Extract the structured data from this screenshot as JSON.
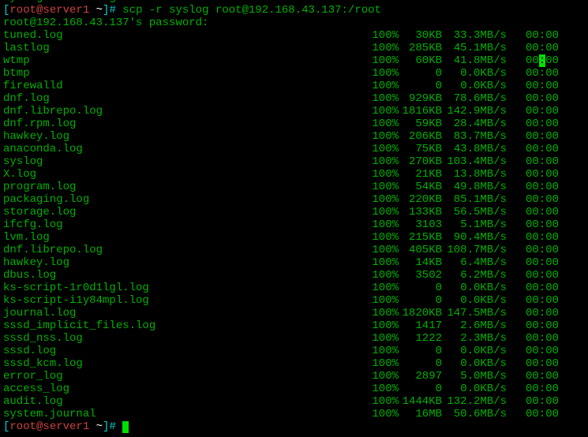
{
  "top_fragment": "syslog: not a regular file",
  "prompt1": {
    "open": "[",
    "userhost": "root@server1",
    "tilde": " ~",
    "close": "]# ",
    "command": "scp -r syslog root@192.168.43.137:/root"
  },
  "password_line": "root@192.168.43.137's password:",
  "files": [
    {
      "name": "tuned.log",
      "pct": "100%",
      "size": "30KB",
      "rate": "33.3MB/s",
      "time": "00:00"
    },
    {
      "name": "lastlog",
      "pct": "100%",
      "size": "285KB",
      "rate": "45.1MB/s",
      "time": "00:00"
    },
    {
      "name": "wtmp",
      "pct": "100%",
      "size": "60KB",
      "rate": "41.8MB/s",
      "time": "00:00",
      "time_hl": true,
      "time_pre": "00",
      "time_hl_ch": ":",
      "time_post": "00"
    },
    {
      "name": "btmp",
      "pct": "100%",
      "size": "0",
      "rate": "0.0KB/s",
      "time": "00:00"
    },
    {
      "name": "firewalld",
      "pct": "100%",
      "size": "0",
      "rate": "0.0KB/s",
      "time": "00:00"
    },
    {
      "name": "dnf.log",
      "pct": "100%",
      "size": "929KB",
      "rate": "78.6MB/s",
      "time": "00:00"
    },
    {
      "name": "dnf.librepo.log",
      "pct": "100%",
      "size": "1816KB",
      "rate": "142.9MB/s",
      "time": "00:00"
    },
    {
      "name": "dnf.rpm.log",
      "pct": "100%",
      "size": "59KB",
      "rate": "28.4MB/s",
      "time": "00:00"
    },
    {
      "name": "hawkey.log",
      "pct": "100%",
      "size": "206KB",
      "rate": "83.7MB/s",
      "time": "00:00"
    },
    {
      "name": "anaconda.log",
      "pct": "100%",
      "size": "75KB",
      "rate": "43.8MB/s",
      "time": "00:00"
    },
    {
      "name": "syslog",
      "pct": "100%",
      "size": "270KB",
      "rate": "103.4MB/s",
      "time": "00:00"
    },
    {
      "name": "X.log",
      "pct": "100%",
      "size": "21KB",
      "rate": "13.8MB/s",
      "time": "00:00"
    },
    {
      "name": "program.log",
      "pct": "100%",
      "size": "54KB",
      "rate": "49.8MB/s",
      "time": "00:00"
    },
    {
      "name": "packaging.log",
      "pct": "100%",
      "size": "220KB",
      "rate": "85.1MB/s",
      "time": "00:00"
    },
    {
      "name": "storage.log",
      "pct": "100%",
      "size": "133KB",
      "rate": "56.5MB/s",
      "time": "00:00"
    },
    {
      "name": "ifcfg.log",
      "pct": "100%",
      "size": "3103",
      "rate": "5.1MB/s",
      "time": "00:00"
    },
    {
      "name": "lvm.log",
      "pct": "100%",
      "size": "215KB",
      "rate": "90.4MB/s",
      "time": "00:00"
    },
    {
      "name": "dnf.librepo.log",
      "pct": "100%",
      "size": "405KB",
      "rate": "108.7MB/s",
      "time": "00:00"
    },
    {
      "name": "hawkey.log",
      "pct": "100%",
      "size": "14KB",
      "rate": "6.4MB/s",
      "time": "00:00"
    },
    {
      "name": "dbus.log",
      "pct": "100%",
      "size": "3502",
      "rate": "6.2MB/s",
      "time": "00:00"
    },
    {
      "name": "ks-script-1r0d1lgl.log",
      "pct": "100%",
      "size": "0",
      "rate": "0.0KB/s",
      "time": "00:00"
    },
    {
      "name": "ks-script-i1y84mpl.log",
      "pct": "100%",
      "size": "0",
      "rate": "0.0KB/s",
      "time": "00:00"
    },
    {
      "name": "journal.log",
      "pct": "100%",
      "size": "1820KB",
      "rate": "147.5MB/s",
      "time": "00:00"
    },
    {
      "name": "sssd_implicit_files.log",
      "pct": "100%",
      "size": "1417",
      "rate": "2.6MB/s",
      "time": "00:00"
    },
    {
      "name": "sssd_nss.log",
      "pct": "100%",
      "size": "1222",
      "rate": "2.3MB/s",
      "time": "00:00"
    },
    {
      "name": "sssd.log",
      "pct": "100%",
      "size": "0",
      "rate": "0.0KB/s",
      "time": "00:00"
    },
    {
      "name": "sssd_kcm.log",
      "pct": "100%",
      "size": "0",
      "rate": "0.0KB/s",
      "time": "00:00"
    },
    {
      "name": "error_log",
      "pct": "100%",
      "size": "2897",
      "rate": "5.0MB/s",
      "time": "00:00"
    },
    {
      "name": "access_log",
      "pct": "100%",
      "size": "0",
      "rate": "0.0KB/s",
      "time": "00:00"
    },
    {
      "name": "audit.log",
      "pct": "100%",
      "size": "1444KB",
      "rate": "132.2MB/s",
      "time": "00:00"
    },
    {
      "name": "system.journal",
      "pct": "100%",
      "size": "16MB",
      "rate": "50.6MB/s",
      "time": "00:00"
    }
  ],
  "prompt2": {
    "open": "[",
    "userhost": "root@server1",
    "tilde": " ~",
    "close": "]# "
  }
}
